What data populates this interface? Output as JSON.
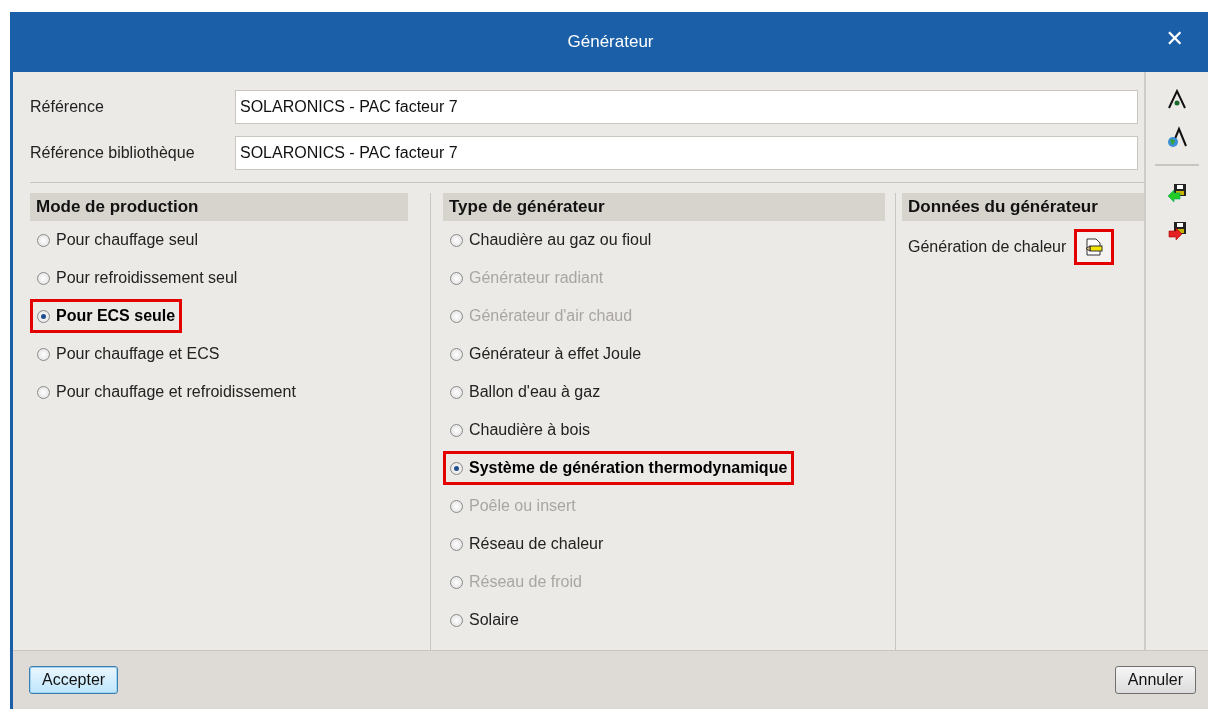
{
  "window": {
    "title": "Générateur",
    "close": "✕"
  },
  "fields": [
    {
      "label": "Référence",
      "value": "SOLARONICS - PAC facteur 7"
    },
    {
      "label": "Référence bibliothèque",
      "value": "SOLARONICS - PAC facteur 7"
    }
  ],
  "production_mode": {
    "title": "Mode de production",
    "options": [
      {
        "label": "Pour chauffage seul",
        "selected": false,
        "disabled": false,
        "highlighted": false
      },
      {
        "label": "Pour refroidissement seul",
        "selected": false,
        "disabled": false,
        "highlighted": false
      },
      {
        "label": "Pour ECS seule",
        "selected": true,
        "disabled": false,
        "highlighted": true
      },
      {
        "label": "Pour chauffage et ECS",
        "selected": false,
        "disabled": false,
        "highlighted": false
      },
      {
        "label": "Pour chauffage et refroidissement",
        "selected": false,
        "disabled": false,
        "highlighted": false
      }
    ]
  },
  "generator_type": {
    "title": "Type de générateur",
    "options": [
      {
        "label": "Chaudière au gaz ou fioul",
        "selected": false,
        "disabled": false,
        "highlighted": false
      },
      {
        "label": "Générateur radiant",
        "selected": false,
        "disabled": true,
        "highlighted": false
      },
      {
        "label": "Générateur d'air chaud",
        "selected": false,
        "disabled": true,
        "highlighted": false
      },
      {
        "label": "Générateur à effet Joule",
        "selected": false,
        "disabled": false,
        "highlighted": false
      },
      {
        "label": "Ballon d'eau à gaz",
        "selected": false,
        "disabled": false,
        "highlighted": false
      },
      {
        "label": "Chaudière à bois",
        "selected": false,
        "disabled": false,
        "highlighted": false
      },
      {
        "label": "Système de génération thermodynamique",
        "selected": true,
        "disabled": false,
        "highlighted": true
      },
      {
        "label": "Poêle ou insert",
        "selected": false,
        "disabled": true,
        "highlighted": false
      },
      {
        "label": "Réseau de chaleur",
        "selected": false,
        "disabled": false,
        "highlighted": false
      },
      {
        "label": "Réseau de froid",
        "selected": false,
        "disabled": true,
        "highlighted": false
      },
      {
        "label": "Solaire",
        "selected": false,
        "disabled": false,
        "highlighted": false
      }
    ]
  },
  "generator_data": {
    "title": "Données du générateur",
    "items": [
      {
        "label": "Génération de chaleur",
        "highlighted": true
      }
    ]
  },
  "buttons": [
    {
      "label": "Accepter",
      "focused": true
    },
    {
      "label": "Annuler",
      "focused": false
    }
  ]
}
